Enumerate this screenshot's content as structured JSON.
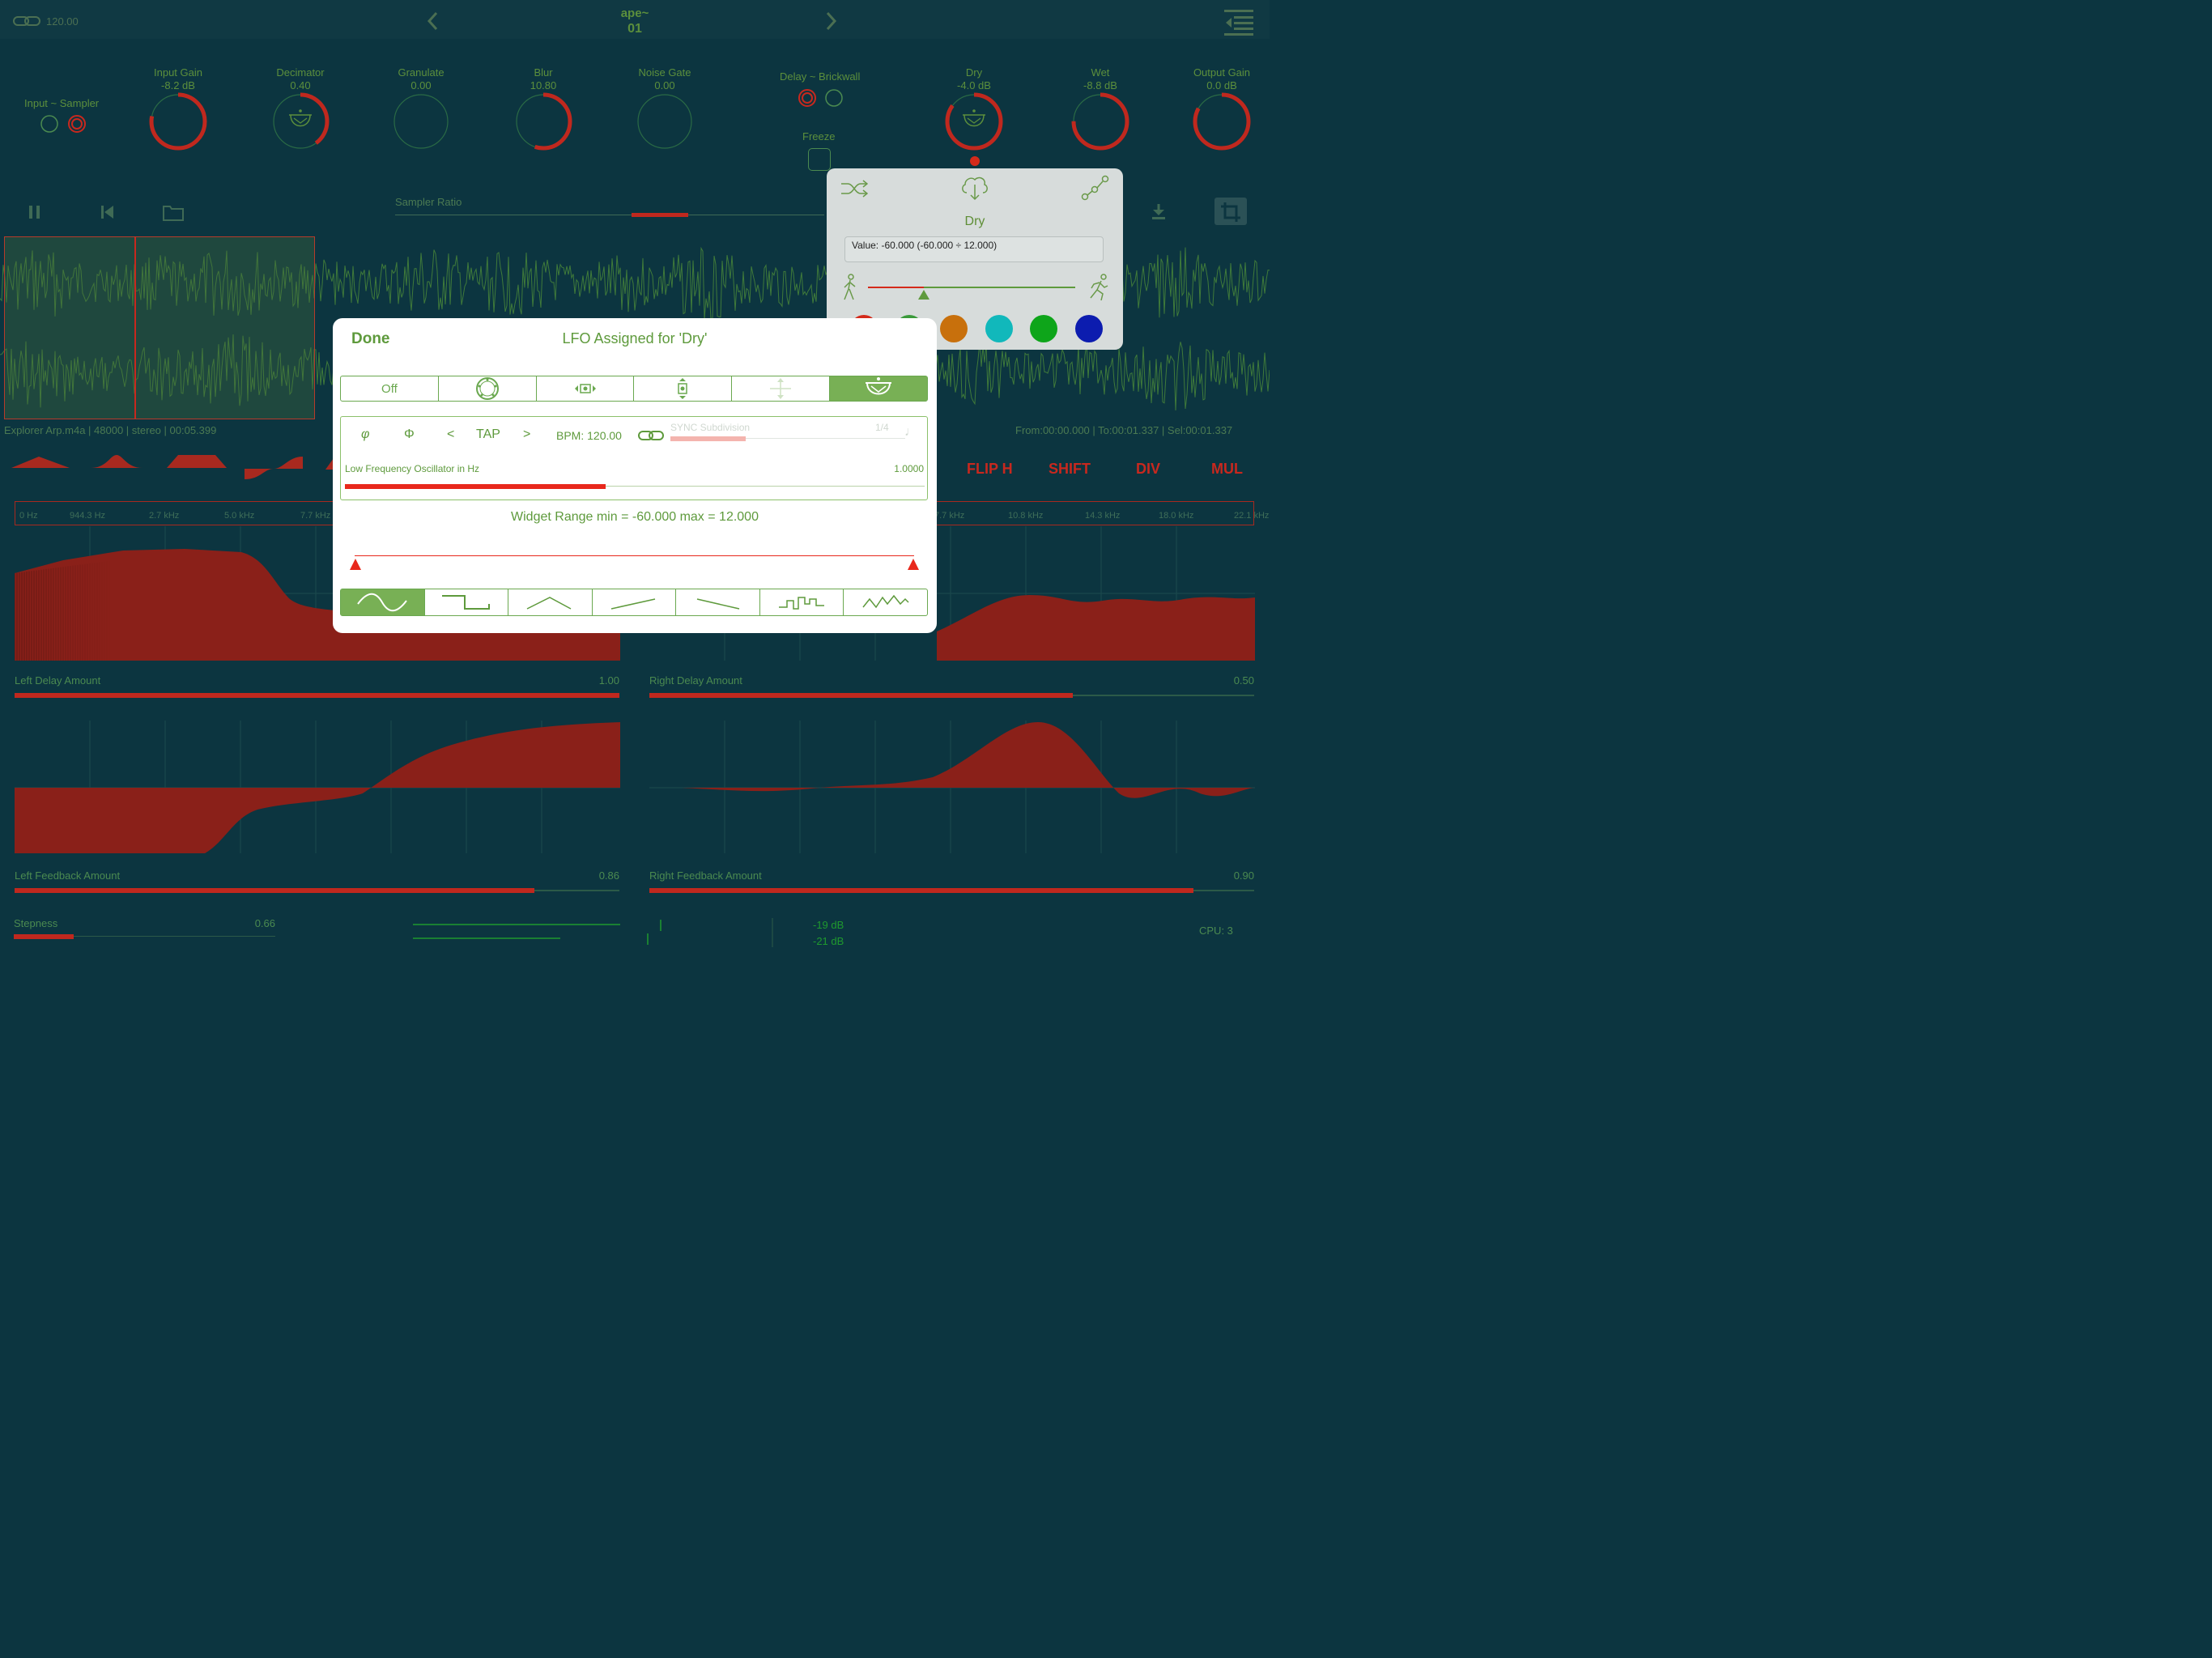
{
  "topbar": {
    "tempo": "120.00",
    "title": "ape~",
    "preset": "01"
  },
  "knobs": [
    {
      "label": "Input Gain",
      "value": "-8.2 dB",
      "level": 0.78
    },
    {
      "label": "Decimator",
      "value": "0.40",
      "level": 0.4
    },
    {
      "label": "Granulate",
      "value": "0.00",
      "level": 0.0
    },
    {
      "label": "Blur",
      "value": "10.80",
      "level": 0.55
    },
    {
      "label": "Noise Gate",
      "value": "0.00",
      "level": 0.0
    },
    {
      "label": "Dry",
      "value": "-4.0 dB",
      "level": 0.85
    },
    {
      "label": "Wet",
      "value": "-8.8 dB",
      "level": 0.75
    },
    {
      "label": "Output Gain",
      "value": "0.0 dB",
      "level": 0.83
    }
  ],
  "input_sampler": {
    "label": "Input ~ Sampler"
  },
  "delay_brickwall": {
    "label": "Delay ~ Brickwall"
  },
  "freeze": {
    "label": "Freeze"
  },
  "sampler_ratio": {
    "label": "Sampler Ratio"
  },
  "file_info": {
    "left": "Explorer Arp.m4a | 48000 | stereo  | 00:05.399",
    "right": "From:00:00.000 | To:00:01.337 | Sel:00:01.337"
  },
  "tools": {
    "flip_h": "FLIP H",
    "shift": "SHIFT",
    "div": "DIV",
    "mul": "MUL"
  },
  "freq_ticks_left": [
    "0 Hz",
    "944.3 Hz",
    "2.7 kHz",
    "5.0 kHz",
    "7.7 kHz"
  ],
  "freq_ticks_right": [
    "7.7 kHz",
    "10.8 kHz",
    "14.3 kHz",
    "18.0 kHz",
    "22.1 kHz"
  ],
  "params": {
    "left_delay": {
      "label": "Left Delay Amount",
      "value": "1.00",
      "level": 1.0
    },
    "right_delay": {
      "label": "Right Delay Amount",
      "value": "0.50",
      "level": 0.7
    },
    "left_feedback": {
      "label": "Left Feedback Amount",
      "value": "0.86",
      "level": 0.86
    },
    "right_feedback": {
      "label": "Right Feedback Amount",
      "value": "0.90",
      "level": 0.9
    },
    "stepness": {
      "label": "Stepness",
      "value": "0.66",
      "level": 0.23
    }
  },
  "meters": {
    "db1": "-19 dB",
    "db2": "-21 dB"
  },
  "cpu": "CPU: 3",
  "popover": {
    "title": "Dry",
    "value": "Value: -60.000 (-60.000 ÷ 12.000)",
    "level": 0.27,
    "colors": [
      "#d42a1a",
      "#3a9a3a",
      "#c8700c",
      "#11b8bb",
      "#0ea51a",
      "#0c1caf"
    ]
  },
  "modal": {
    "done": "Done",
    "title": "LFO Assigned for 'Dry'",
    "off": "Off",
    "phase_a": "φ",
    "phase_b": "Φ",
    "prev": "<",
    "tap": "TAP",
    "next": ">",
    "bpm": "BPM: 120.00",
    "sync_label": "SYNC Subdivision",
    "sync_value": "1/4",
    "sync_level": 0.32,
    "lfo_label": "Low Frequency Oscillator in Hz",
    "lfo_value": "1.0000",
    "lfo_level": 0.45,
    "range": "Widget Range min = -60.000 max = 12.000"
  }
}
